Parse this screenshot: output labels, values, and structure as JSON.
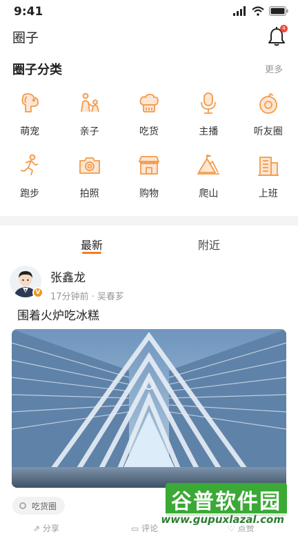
{
  "status_bar": {
    "time": "9:41"
  },
  "header": {
    "title": "圈子",
    "notification_count": "4"
  },
  "categories_section": {
    "title": "圈子分类",
    "more_label": "更多",
    "items": [
      {
        "label": "萌宠",
        "icon": "pet-dog-icon"
      },
      {
        "label": "亲子",
        "icon": "parent-child-icon"
      },
      {
        "label": "吃货",
        "icon": "chef-hat-icon"
      },
      {
        "label": "主播",
        "icon": "microphone-icon"
      },
      {
        "label": "听友圈",
        "icon": "headphone-circle-icon"
      },
      {
        "label": "跑步",
        "icon": "running-icon"
      },
      {
        "label": "拍照",
        "icon": "camera-icon"
      },
      {
        "label": "购物",
        "icon": "shop-icon"
      },
      {
        "label": "爬山",
        "icon": "mountain-icon"
      },
      {
        "label": "上班",
        "icon": "office-building-icon"
      }
    ]
  },
  "feed_tabs": {
    "latest": "最新",
    "nearby": "附近"
  },
  "post": {
    "author": "张鑫龙",
    "meta": "17分钟前 · 吴春芗",
    "verified_badge": "V",
    "title": "围着火炉吃冰糕",
    "tag": "吃货圈",
    "actions": {
      "share": "分享",
      "comment": "评论",
      "like": "点赞"
    }
  },
  "watermark": {
    "name": "谷普软件园",
    "url": "www.gupuxlazal.com"
  },
  "colors": {
    "accent": "#f47b20",
    "icon_orange": "#f39a4a",
    "watermark_green": "#3aa935"
  }
}
